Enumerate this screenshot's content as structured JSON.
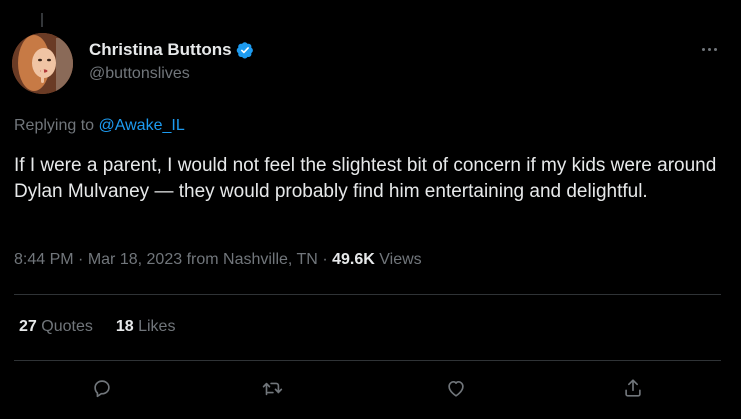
{
  "author": {
    "display_name": "Christina Buttons",
    "handle": "@buttonslives",
    "verified_color": "#1d9bf0"
  },
  "reply": {
    "prefix": "Replying to",
    "mention": "@Awake_IL"
  },
  "tweet": {
    "text": "If I were a parent, I would not feel the slightest bit of concern if my kids were around Dylan Mulvaney — they would probably find him entertaining and delightful."
  },
  "meta": {
    "time": "8:44 PM",
    "date": "Mar 18, 2023",
    "location": "from Nashville, TN",
    "views_count": "49.6K",
    "views_label": "Views"
  },
  "stats": {
    "quotes_count": "27",
    "quotes_label": "Quotes",
    "likes_count": "18",
    "likes_label": "Likes"
  },
  "icons": {
    "reply": "reply-icon",
    "retweet": "retweet-icon",
    "like": "like-icon",
    "share": "share-icon",
    "more": "more-icon"
  },
  "colors": {
    "background": "#000000",
    "text": "#e7e9ea",
    "secondary": "#71767b",
    "accent": "#1d9bf0",
    "divider": "#2f3336"
  }
}
